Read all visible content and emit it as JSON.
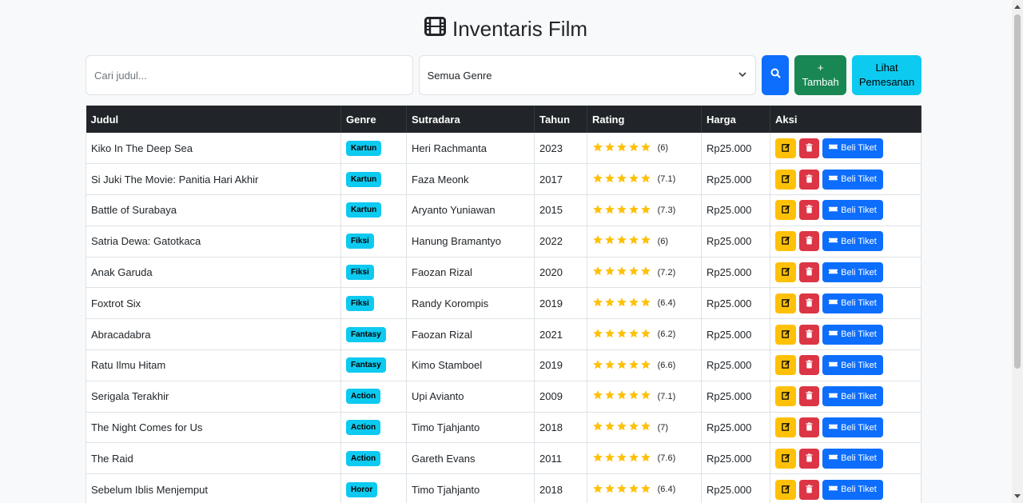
{
  "title": "Inventaris Film",
  "search": {
    "placeholder": "Cari judul..."
  },
  "genre_filter": {
    "selected": "Semua Genre"
  },
  "buttons": {
    "add_line1": "+",
    "add_line2": "Tambah",
    "orders_line1": "Lihat",
    "orders_line2": "Pemesanan",
    "buy": "Beli Tiket"
  },
  "table": {
    "headers": [
      "Judul",
      "Genre",
      "Sutradara",
      "Tahun",
      "Rating",
      "Harga",
      "Aksi"
    ],
    "rows": [
      {
        "title": "Kiko In The Deep Sea",
        "genre": "Kartun",
        "director": "Heri Rachmanta",
        "year": "2023",
        "rating": "(6)",
        "price": "Rp25.000"
      },
      {
        "title": "Si Juki The Movie: Panitia Hari Akhir",
        "genre": "Kartun",
        "director": "Faza Meonk",
        "year": "2017",
        "rating": "(7.1)",
        "price": "Rp25.000"
      },
      {
        "title": "Battle of Surabaya",
        "genre": "Kartun",
        "director": "Aryanto Yuniawan",
        "year": "2015",
        "rating": "(7.3)",
        "price": "Rp25.000"
      },
      {
        "title": "Satria Dewa: Gatotkaca",
        "genre": "Fiksi",
        "director": "Hanung Bramantyo",
        "year": "2022",
        "rating": "(6)",
        "price": "Rp25.000"
      },
      {
        "title": "Anak Garuda",
        "genre": "Fiksi",
        "director": "Faozan Rizal",
        "year": "2020",
        "rating": "(7.2)",
        "price": "Rp25.000"
      },
      {
        "title": "Foxtrot Six",
        "genre": "Fiksi",
        "director": "Randy Korompis",
        "year": "2019",
        "rating": "(6.4)",
        "price": "Rp25.000"
      },
      {
        "title": "Abracadabra",
        "genre": "Fantasy",
        "director": "Faozan Rizal",
        "year": "2021",
        "rating": "(6.2)",
        "price": "Rp25.000"
      },
      {
        "title": "Ratu Ilmu Hitam",
        "genre": "Fantasy",
        "director": "Kimo Stamboel",
        "year": "2019",
        "rating": "(6.6)",
        "price": "Rp25.000"
      },
      {
        "title": "Serigala Terakhir",
        "genre": "Action",
        "director": "Upi Avianto",
        "year": "2009",
        "rating": "(7.1)",
        "price": "Rp25.000"
      },
      {
        "title": "The Night Comes for Us",
        "genre": "Action",
        "director": "Timo Tjahjanto",
        "year": "2018",
        "rating": "(7)",
        "price": "Rp25.000"
      },
      {
        "title": "The Raid",
        "genre": "Action",
        "director": "Gareth Evans",
        "year": "2011",
        "rating": "(7.6)",
        "price": "Rp25.000"
      },
      {
        "title": "Sebelum Iblis Menjemput",
        "genre": "Horor",
        "director": "Timo Tjahjanto",
        "year": "2018",
        "rating": "(6.4)",
        "price": "Rp25.000"
      }
    ]
  },
  "icons": {
    "title": "film-icon",
    "search": "search-icon",
    "select": "chevron-down-icon",
    "star": "star-icon",
    "edit": "edit-icon",
    "delete": "trash-icon",
    "ticket": "ticket-icon"
  },
  "colors": {
    "primary": "#0d6efd",
    "success": "#198754",
    "info": "#0dcaf0",
    "warning": "#ffc107",
    "danger": "#dc3545",
    "dark": "#212529",
    "star": "#ffc107"
  }
}
